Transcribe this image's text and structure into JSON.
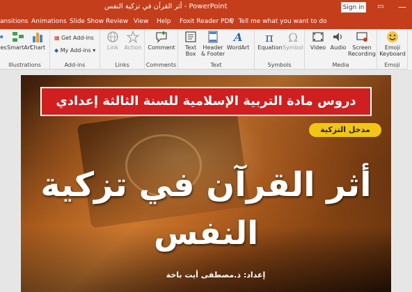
{
  "window": {
    "title": "أثر القرآن في تزكية النفس  -  PowerPoint",
    "signin_label": "Sign in",
    "minimize_label": "—"
  },
  "tabs": [
    "ansitions",
    "Animations",
    "Slide Show",
    "Review",
    "View",
    "Help",
    "Foxit Reader PDF"
  ],
  "tell_me": "Tell me what you want to do",
  "ribbon": {
    "illustrations": {
      "label": "Illustrations",
      "items": [
        "es",
        "SmartArt",
        "Chart"
      ]
    },
    "addins": {
      "label": "Add-ins",
      "get": "Get Add-ins",
      "my": "My Add-ins"
    },
    "links": {
      "label": "Links",
      "items": [
        "Link",
        "Action"
      ]
    },
    "comments": {
      "label": "Comments",
      "items": [
        "Comment"
      ]
    },
    "text": {
      "label": "Text",
      "textbox": [
        "Text",
        "Box"
      ],
      "header": [
        "Header",
        "& Footer"
      ],
      "wordart": "WordArt"
    },
    "symbols": {
      "label": "Symbols",
      "equation": "Equation",
      "symbol": "Symbol"
    },
    "media": {
      "label": "Media",
      "video": "Video",
      "audio": "Audio",
      "screen": [
        "Screen",
        "Recording"
      ]
    },
    "emoji": {
      "label": "Emoji",
      "keyboard": [
        "Emoji",
        "Keyboard"
      ]
    }
  },
  "slide": {
    "banner": "دروس مادة التربية الإسلامية للسنة الثالثة إعدادي",
    "pill": "مدخل التزكية",
    "title_line1": "أثر القرآن في تزكية",
    "title_line2": "النفس",
    "author": "إعداد: ذ.مصطفى أيت باخة"
  },
  "colors": {
    "titlebar": "#c43e1c",
    "banner": "#cf1f1f",
    "pill": "#f2c613"
  }
}
